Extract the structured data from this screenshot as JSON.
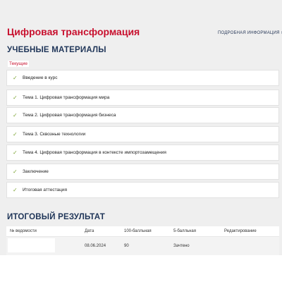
{
  "course": {
    "title": "Цифровая трансформация",
    "more_info": "ПОДРОБНАЯ ИНФОРМАЦИЯ",
    "more_icon": "chevron-right-icon"
  },
  "materials": {
    "heading": "УЧЕБНЫЕ МАТЕРИАЛЫ",
    "current_tag": "Текущие",
    "check_color": "#7fa63a",
    "items": [
      {
        "label": "Введение в курс"
      },
      {
        "label": "Тема 1. Цифровая трансформация мира"
      },
      {
        "label": "Тема 2. Цифровая трансформация бизнеса"
      },
      {
        "label": "Тема 3. Сквозные технологии"
      },
      {
        "label": "Тема 4. Цифровая трансформация в контексте импортозамещения"
      },
      {
        "label": "Заключение"
      },
      {
        "label": "Итоговая аттестация"
      }
    ]
  },
  "results": {
    "heading": "ИТОГОВЫЙ РЕЗУЛЬТАТ",
    "columns": [
      "№ ведомости",
      "Дата",
      "100-балльная",
      "5-балльная",
      "Редактирование"
    ],
    "rows": [
      {
        "statement": "",
        "date": "08.06.2024",
        "score100": "90",
        "score5": "Зачтено",
        "edit": ""
      }
    ]
  },
  "colors": {
    "accent": "#c8102e",
    "heading": "#1f3558"
  }
}
